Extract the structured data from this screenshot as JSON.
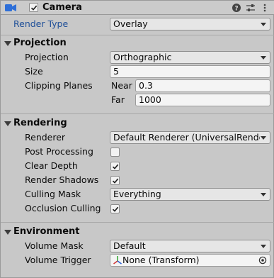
{
  "header": {
    "title": "Camera",
    "camera_icon": "camera-icon",
    "enabled": true,
    "help_icon": "help-icon",
    "preset_icon": "preset-sliders-icon",
    "menu_icon": "kebab-menu-icon"
  },
  "render_type": {
    "label": "Render Type",
    "value": "Overlay"
  },
  "projection_section": {
    "title": "Projection",
    "projection": {
      "label": "Projection",
      "value": "Orthographic"
    },
    "size": {
      "label": "Size",
      "value": "5"
    },
    "clipping": {
      "label": "Clipping Planes",
      "near_label": "Near",
      "near_value": "0.3",
      "far_label": "Far",
      "far_value": "1000"
    }
  },
  "rendering_section": {
    "title": "Rendering",
    "renderer": {
      "label": "Renderer",
      "value": "Default Renderer (UniversalRenderPipelineAsset_Renderer)"
    },
    "post_processing": {
      "label": "Post Processing",
      "checked": false
    },
    "clear_depth": {
      "label": "Clear Depth",
      "checked": true
    },
    "render_shadows": {
      "label": "Render Shadows",
      "checked": true
    },
    "culling_mask": {
      "label": "Culling Mask",
      "value": "Everything"
    },
    "occlusion_culling": {
      "label": "Occlusion Culling",
      "checked": true
    }
  },
  "environment_section": {
    "title": "Environment",
    "volume_mask": {
      "label": "Volume Mask",
      "value": "Default"
    },
    "volume_trigger": {
      "label": "Volume Trigger",
      "value": "None (Transform)",
      "icon": "transform-icon",
      "picker_icon": "object-picker-icon"
    }
  },
  "colors": {
    "background": "#c8c8c8",
    "header_icon_blue": "#2e6fd8",
    "render_type_label": "#1f4f98",
    "transform_red": "#d23a3a",
    "transform_green": "#3aa83a",
    "transform_blue": "#2d63d6"
  }
}
